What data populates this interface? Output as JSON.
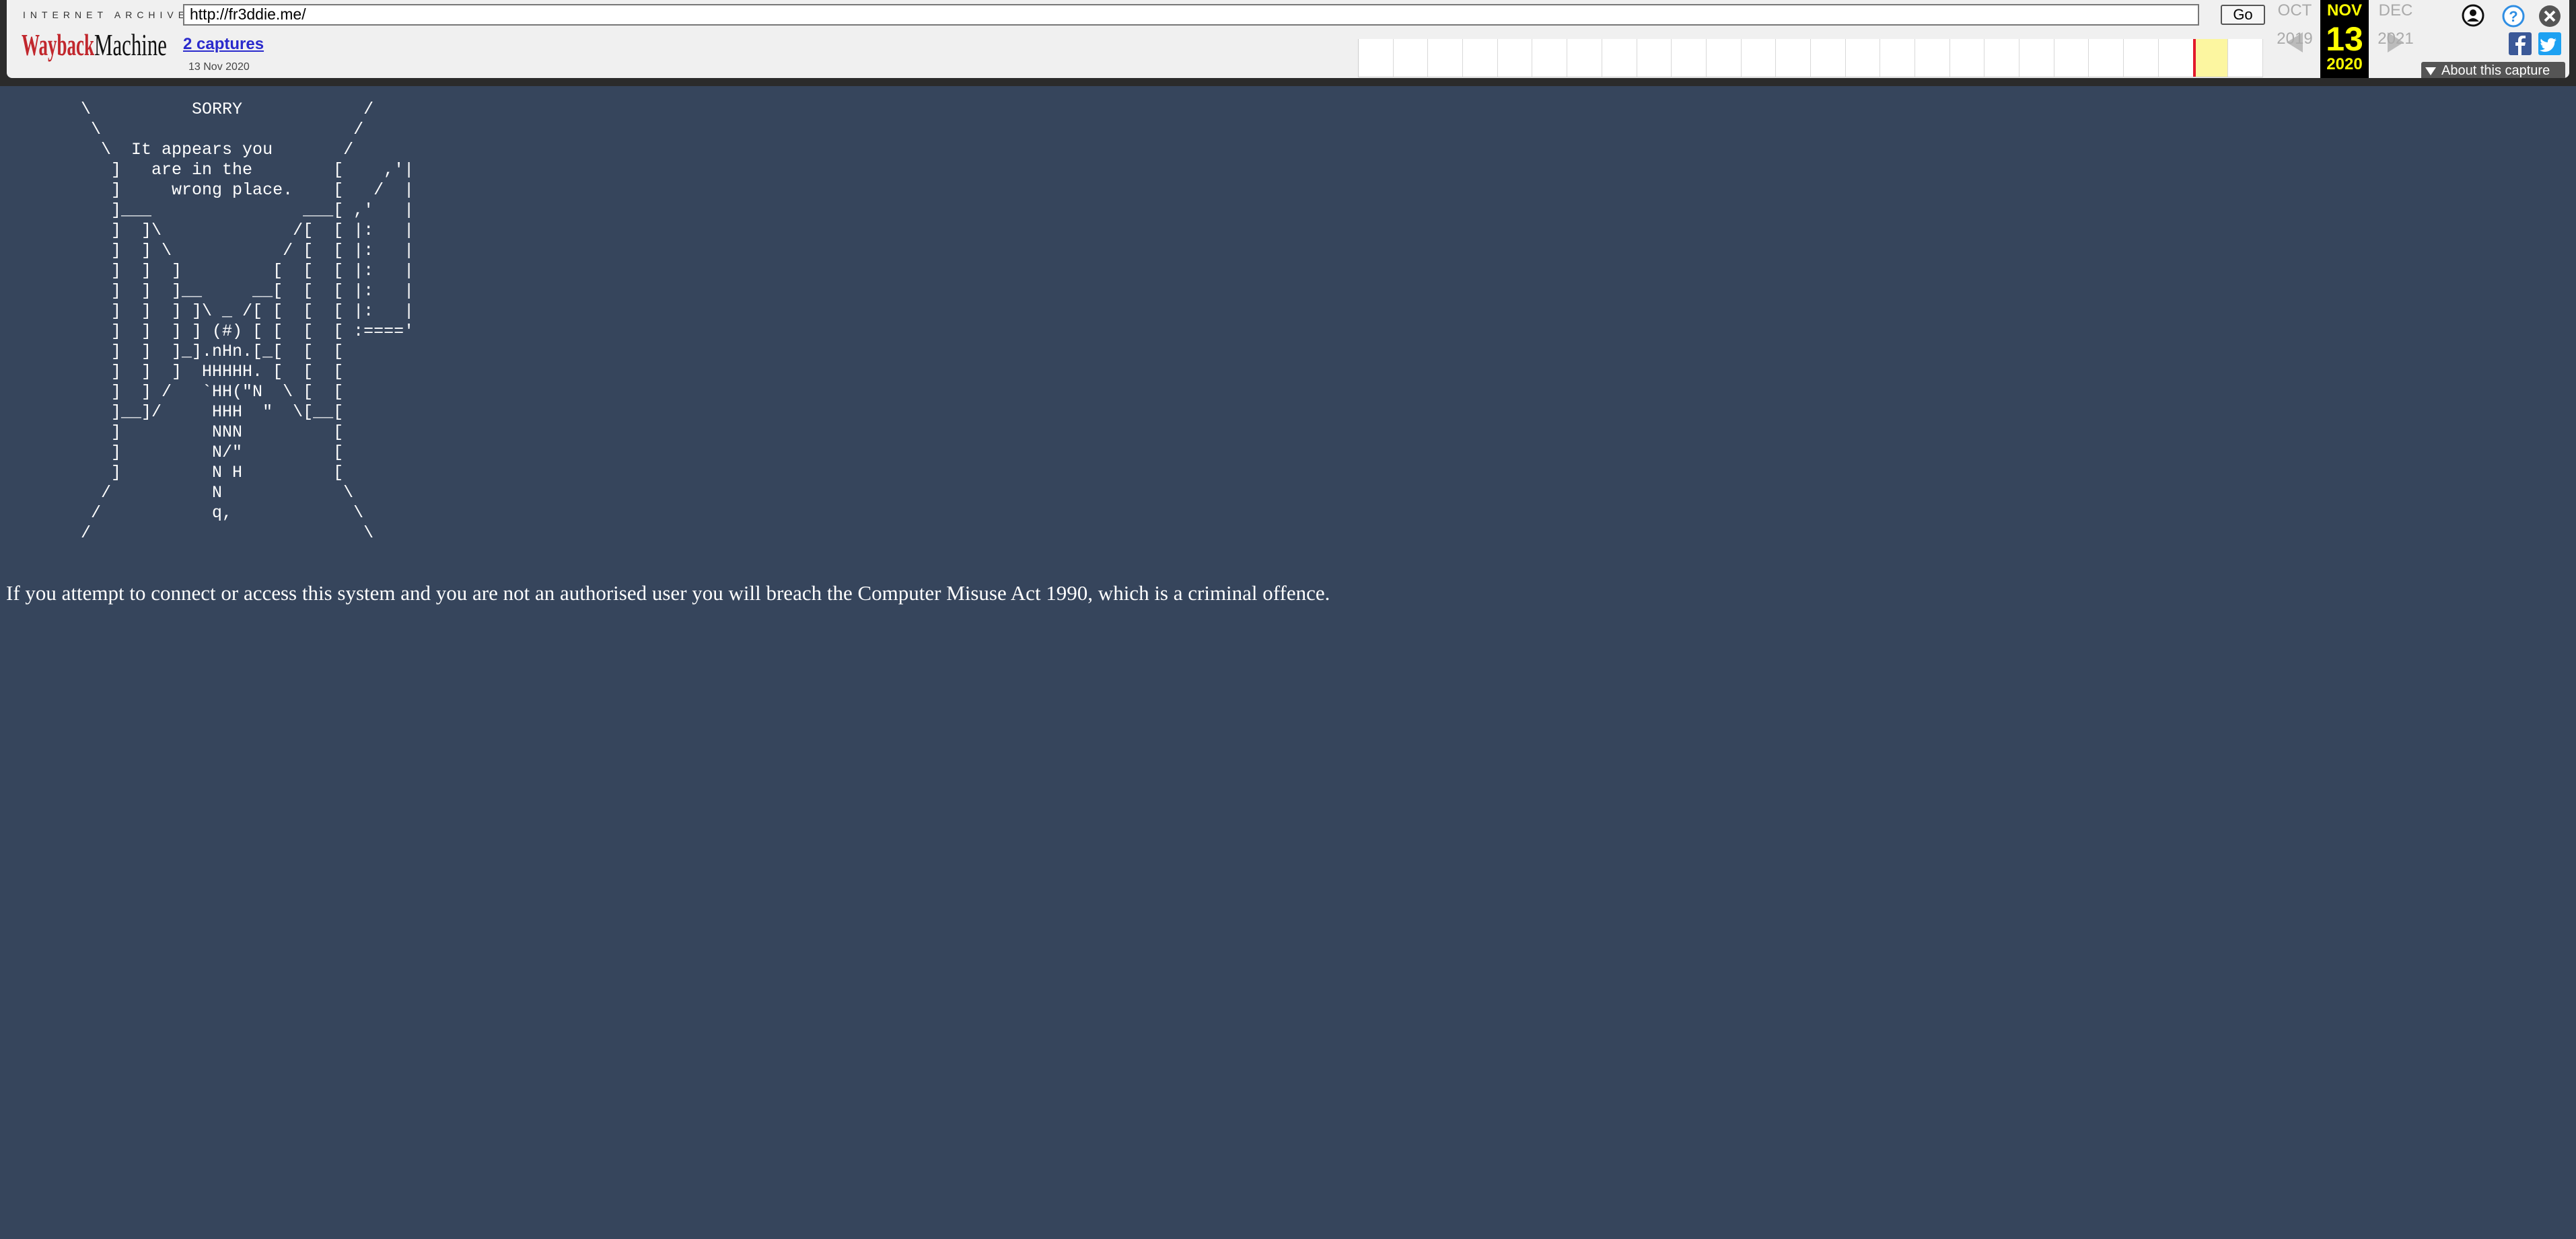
{
  "colors": {
    "page_background": "#36455c",
    "text": "#ffffff",
    "toolbar_background": "#f0f0f0",
    "capture_marker": "#e21a2c",
    "current_year_highlight": "#ffff00"
  },
  "wayback": {
    "brand_top": "INTERNET ARCHIVE",
    "logo_text": "WaybackMachine",
    "url_value": "http://fr3ddie.me/",
    "go_label": "Go",
    "captures_link": "2 captures",
    "capture_date": "13 Nov 2020",
    "sparkline_columns": 26,
    "calendar": {
      "prev_month": "OCT",
      "current_month": "NOV",
      "next_month": "DEC",
      "current_day": "13",
      "prev_year": "2019",
      "current_year": "2020",
      "next_year": "2021"
    },
    "about_label": "About this capture",
    "icons": [
      "user-icon",
      "help-icon",
      "close-icon",
      "facebook-icon",
      "twitter-icon"
    ]
  },
  "content": {
    "ascii_art": "        \\          SORRY            /\n         \\                         /\n          \\  It appears you       /\n           ]   are in the        [    ,'|\n           ]     wrong place.    [   /  |\n           ]___               ___[ ,'   |\n           ]  ]\\             /[  [ |:   |\n           ]  ] \\           / [  [ |:   |\n           ]  ]  ]         [  [  [ |:   |\n           ]  ]  ]__     __[  [  [ |:   |\n           ]  ]  ] ]\\ _ /[ [  [  [ |:   |\n           ]  ]  ] ] (#) [ [  [  [ :====' \n           ]  ]  ]_].nHn.[_[  [  [\n           ]  ]  ]  HHHHH. [  [  [\n           ]  ] /   `HH(\"N  \\ [  [\n           ]__]/     HHH  \"  \\[__[\n           ]         NNN         [\n           ]         N/\"         [\n           ]         N H         [\n          /          N            \\\n         /           q,            \\\n        /                           \\",
    "warning": "If you attempt to connect or access this system and you are not an authorised user you will breach the Computer Misuse Act 1990, which is a criminal offence."
  }
}
